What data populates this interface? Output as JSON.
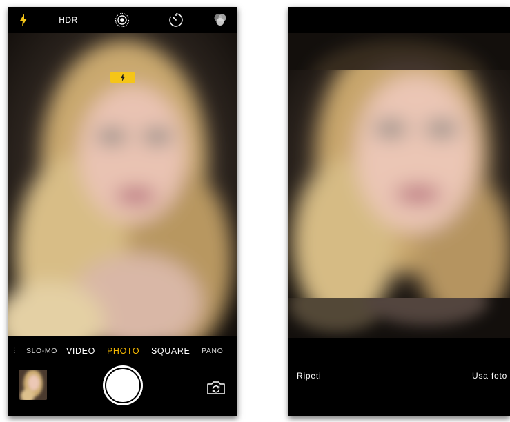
{
  "camera": {
    "top_bar": {
      "flash_icon": "flash-icon",
      "hdr_label": "HDR",
      "live_photo_icon": "live-photo-icon",
      "timer_icon": "timer-icon",
      "filters_icon": "filters-icon"
    },
    "flash_indicator_icon": "flash-icon",
    "modes": [
      {
        "label": "SLO-MO",
        "active": false
      },
      {
        "label": "VIDEO",
        "active": false
      },
      {
        "label": "PHOTO",
        "active": true
      },
      {
        "label": "SQUARE",
        "active": false
      },
      {
        "label": "PANO",
        "active": false
      }
    ],
    "accent_color": "#f5b800",
    "flash_color": "#f5c518",
    "shutter_icon": "shutter-button",
    "switch_camera_icon": "switch-camera-icon",
    "thumbnail": "last-photo-thumbnail"
  },
  "review": {
    "retake_label": "Ripeti",
    "use_photo_label": "Usa foto"
  }
}
